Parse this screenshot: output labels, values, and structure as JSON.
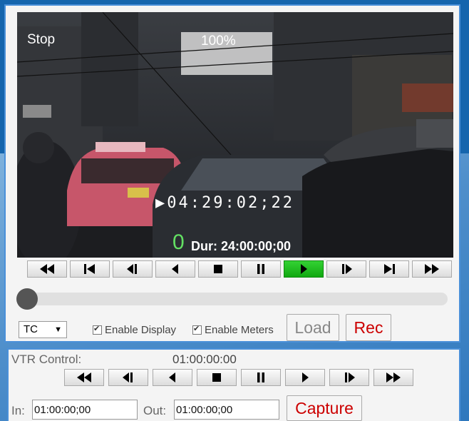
{
  "player": {
    "osd": {
      "state": "Stop",
      "speed": "100%",
      "timecode": "▶04:29:02;22",
      "meter": "0",
      "duration": "Dur: 24:00:00;00"
    },
    "transport": [
      {
        "icon": "rewind-icon",
        "active": false
      },
      {
        "icon": "go-to-start-icon",
        "active": false
      },
      {
        "icon": "step-back-icon",
        "active": false
      },
      {
        "icon": "reverse-play-icon",
        "active": false
      },
      {
        "icon": "stop-icon",
        "active": false
      },
      {
        "icon": "pause-icon",
        "active": false
      },
      {
        "icon": "play-icon",
        "active": true
      },
      {
        "icon": "step-forward-icon",
        "active": false
      },
      {
        "icon": "go-to-end-icon",
        "active": false
      },
      {
        "icon": "fast-forward-icon",
        "active": false
      }
    ],
    "position": 0,
    "tc_select": "TC",
    "enable_display": "Enable Display",
    "enable_meters": "Enable Meters",
    "load": "Load",
    "rec": "Rec",
    "colors": {
      "active_button": "#22bb22",
      "rec_text": "#cc0000",
      "panel_border": "#4a90d9"
    }
  },
  "vtr": {
    "label": "VTR Control:",
    "timecode": "01:00:00:00",
    "transport": [
      {
        "icon": "rewind-icon"
      },
      {
        "icon": "step-back-icon"
      },
      {
        "icon": "reverse-play-icon"
      },
      {
        "icon": "stop-icon"
      },
      {
        "icon": "pause-icon"
      },
      {
        "icon": "play-icon"
      },
      {
        "icon": "step-forward-icon"
      },
      {
        "icon": "fast-forward-icon"
      }
    ],
    "in_label": "In:",
    "in_value": "01:00:00;00",
    "out_label": "Out:",
    "out_value": "01:00:00;00",
    "capture": "Capture"
  }
}
